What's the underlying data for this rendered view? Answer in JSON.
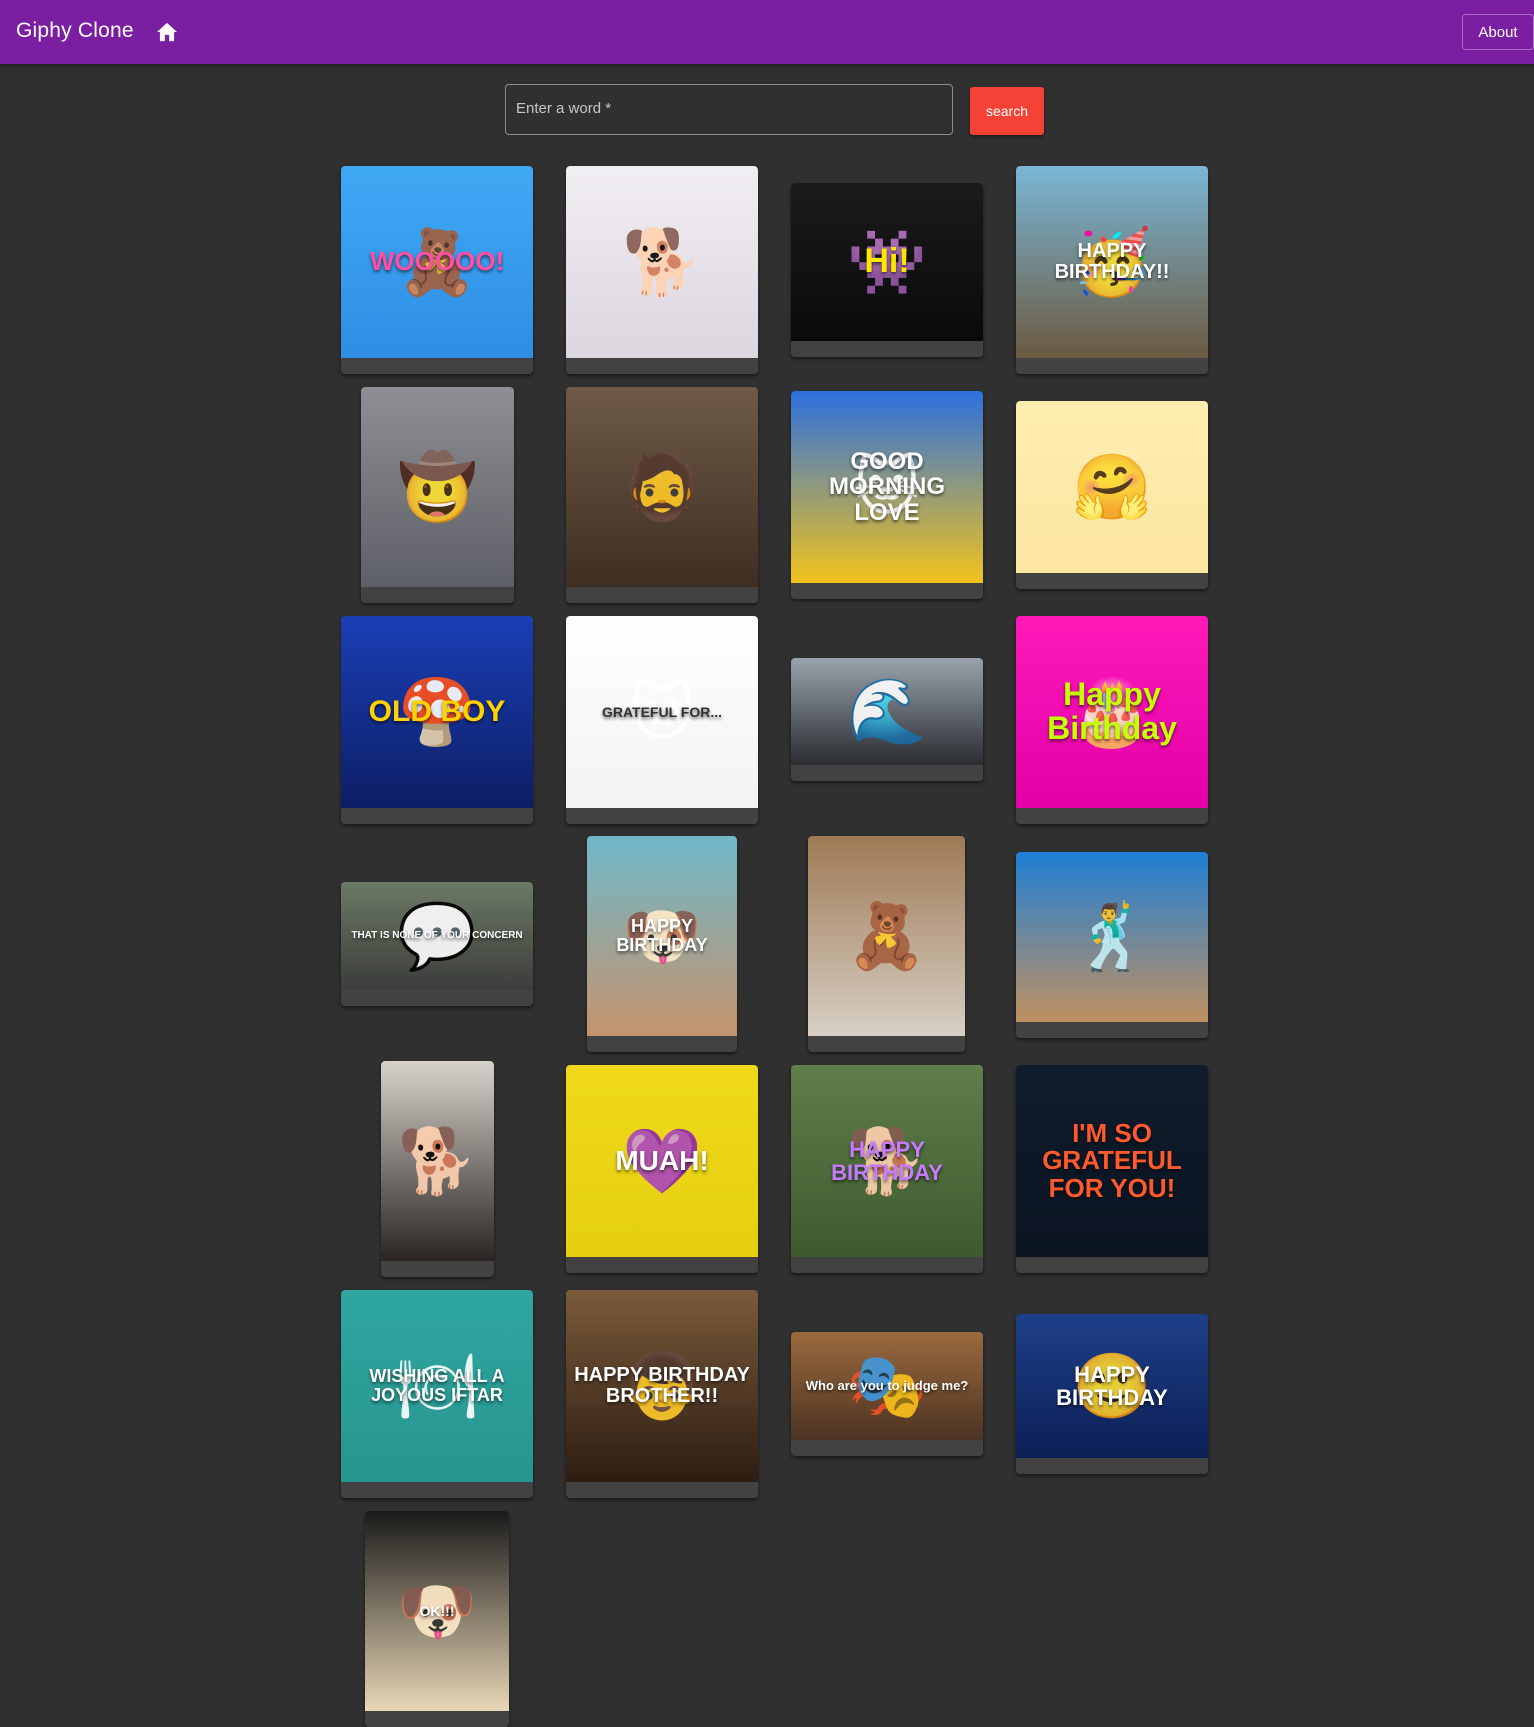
{
  "appbar": {
    "title": "Giphy Clone",
    "about_label": "About",
    "color": "#7b1fa2"
  },
  "search": {
    "placeholder": "Enter a word *",
    "button_label": "search",
    "button_color": "#f44336"
  },
  "gifs": [
    {
      "caption": "WOOOOO!",
      "icon": "teddy-bear-icon",
      "bg": "linear-gradient(180deg,#3fa9f5,#2f8de4)",
      "text_color": "#ff4fa3",
      "glyph": "🧸",
      "font": 26
    },
    {
      "caption": "",
      "icon": "party-dog-icon",
      "bg": "linear-gradient(180deg,#f1eef2,#dcd6df)",
      "text_color": "#000",
      "glyph": "🐕",
      "font": 20
    },
    {
      "caption": "Hi!",
      "icon": "red-monster-icon",
      "bg": "linear-gradient(180deg,#1b1b1b,#0a0a0a)",
      "text_color": "#ffe600",
      "glyph": "👾",
      "font": 34
    },
    {
      "caption": "HAPPY BIRTHDAY!!",
      "icon": "party-hat-icon",
      "bg": "linear-gradient(180deg,#7ab6d6,#6b5a40)",
      "text_color": "#ffffff",
      "glyph": "🥳",
      "font": 20
    },
    {
      "caption": "",
      "icon": "dancing-cowboy-icon",
      "bg": "linear-gradient(180deg,#8d8f94,#5d6066)",
      "text_color": "#fff",
      "glyph": "🤠",
      "font": 20
    },
    {
      "caption": "",
      "icon": "bearded-man-icon",
      "bg": "linear-gradient(180deg,#6e5a46,#3f2e22)",
      "text_color": "#fff",
      "glyph": "🧔",
      "font": 20
    },
    {
      "caption": "GOOD MORNING LOVE",
      "icon": "kitten-icon",
      "bg": "linear-gradient(180deg,#2c6fe0,#f2c31b)",
      "text_color": "#ffffff",
      "glyph": "🐱",
      "font": 24
    },
    {
      "caption": "",
      "icon": "hug-icon",
      "bg": "linear-gradient(180deg,#fdeeb0,#fde6a0)",
      "text_color": "#000",
      "glyph": "🤗",
      "font": 20
    },
    {
      "caption": "OLD BOY",
      "icon": "mushroom-icon",
      "bg": "linear-gradient(180deg,#1a3fb5,#0d1e66)",
      "text_color": "#ffd200",
      "glyph": "🍄",
      "font": 30
    },
    {
      "caption": "GRATEFUL FOR...",
      "icon": "nurse-cat-icon",
      "bg": "linear-gradient(180deg,#ffffff,#f3f3f3)",
      "text_color": "#333333",
      "glyph": "🐱",
      "font": 14
    },
    {
      "caption": "",
      "icon": "boat-sea-icon",
      "bg": "linear-gradient(180deg,#9aa3ad,#2a2c30)",
      "text_color": "#fff",
      "glyph": "🌊",
      "font": 20
    },
    {
      "caption": "Happy Birthday",
      "icon": "birthday-cake-icon",
      "bg": "linear-gradient(180deg,#ff19b9,#e200a8)",
      "text_color": "#c6ff00",
      "glyph": "🎂",
      "font": 32
    },
    {
      "caption": "THAT IS NONE OF YOUR CONCERN",
      "icon": "couple-icon",
      "bg": "linear-gradient(180deg,#6d7a66,#3b3d3a)",
      "text_color": "#ffffff",
      "glyph": "💬",
      "font": 10
    },
    {
      "caption": "HAPPY BIRTHDAY",
      "icon": "chihuahua-icon",
      "bg": "linear-gradient(180deg,#6fb8c9,#c5936d)",
      "text_color": "#ffffff",
      "glyph": "🐶",
      "font": 18
    },
    {
      "caption": "",
      "icon": "teddy-bear-icon",
      "bg": "linear-gradient(180deg,#9e7a55,#d7cfc4)",
      "text_color": "#fff",
      "glyph": "🧸",
      "font": 20
    },
    {
      "caption": "",
      "icon": "shirtless-man-icon",
      "bg": "linear-gradient(180deg,#1e7fd6,#c09060)",
      "text_color": "#fff",
      "glyph": "🕺",
      "font": 20
    },
    {
      "caption": "",
      "icon": "puppy-icon",
      "bg": "linear-gradient(180deg,#d8d2cc,#2a2422)",
      "text_color": "#fff",
      "glyph": "🐕",
      "font": 20
    },
    {
      "caption": "MUAH!",
      "icon": "heart-icon",
      "bg": "linear-gradient(180deg,#f0d91b,#e5cf10)",
      "text_color": "#ffffff",
      "glyph": "💜",
      "font": 28
    },
    {
      "caption": "HAPPY BIRTHDAY",
      "icon": "corgi-icon",
      "bg": "linear-gradient(180deg,#5f7e4a,#3d5a2e)",
      "text_color": "#c57aff",
      "glyph": "🐕",
      "font": 22
    },
    {
      "caption": "I'M SO GRATEFUL FOR YOU!",
      "icon": "gratitude-icon",
      "bg": "linear-gradient(180deg,#0f1c2c,#0b1522)",
      "text_color": "#ff5a2d",
      "glyph": "",
      "font": 26
    },
    {
      "caption": "WISHING ALL A JOYOUS IFTAR",
      "icon": "iftar-icon",
      "bg": "linear-gradient(180deg,#2fa6a0,#27958f)",
      "text_color": "#ffffff",
      "glyph": "🍽",
      "font": 18
    },
    {
      "caption": "HAPPY BIRTHDAY BROTHER!!",
      "icon": "boy-cake-icon",
      "bg": "linear-gradient(180deg,#7a5a3a,#2d1d12)",
      "text_color": "#ffffff",
      "glyph": "👦",
      "font": 20
    },
    {
      "caption": "Who are you to judge me?",
      "icon": "puppet-icon",
      "bg": "linear-gradient(180deg,#9b6a3e,#4b3322)",
      "text_color": "#ffffff",
      "glyph": "🎭",
      "font": 13
    },
    {
      "caption": "HAPPY BIRTHDAY",
      "icon": "smiling-man-icon",
      "bg": "linear-gradient(180deg,#1e3f8a,#0c1f55)",
      "text_color": "#ffffff",
      "glyph": "🙂",
      "font": 22
    },
    {
      "caption": "OK!!!",
      "icon": "smiling-dog-icon",
      "bg": "linear-gradient(180deg,#1a1a1a,#e8d7b6)",
      "text_color": "#ffffff",
      "glyph": "🐶",
      "font": 14
    }
  ]
}
